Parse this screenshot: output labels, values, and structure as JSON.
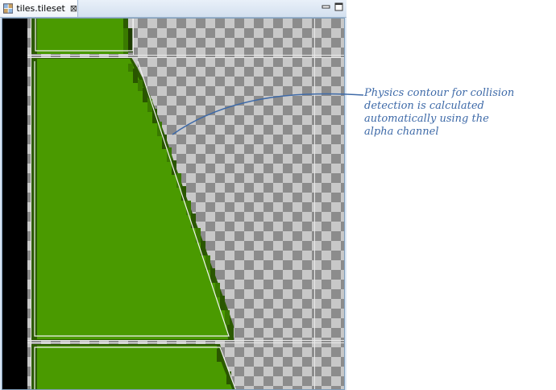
{
  "tab": {
    "title": "tiles.tileset",
    "close_glyph": "⊠"
  },
  "window_controls": [
    "minimize-icon",
    "maximize-icon"
  ],
  "annotation": {
    "lines": [
      "Physics contour for collision",
      "detection is calculated",
      "automatically using the",
      "alpha channel"
    ]
  },
  "colors": {
    "grass": "#4a9a00",
    "grass_edge": "#2c5a00",
    "contour": "#f2f2f2",
    "annotation": "#3e6aa8"
  }
}
